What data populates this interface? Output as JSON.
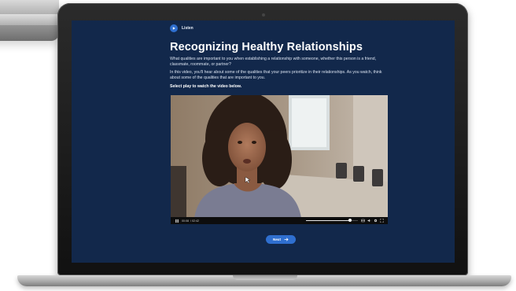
{
  "header": {
    "section_label": "Listen",
    "section_icon": "play-circle-icon"
  },
  "content": {
    "title": "Recognizing Healthy Relationships",
    "paragraph_1": "What qualities are important to you when establishing a relationship with someone, whether this person is a friend, classmate, roommate, or partner?",
    "paragraph_2": "In this video, you'll hear about some of the qualities that your peers prioritize in their relationships. As you watch, think about some of the qualities that are important to you.",
    "instruction": "Select play to watch the video below."
  },
  "player": {
    "current_time": "00:08",
    "duration": "/ 02:42",
    "progress_fraction": 0.05,
    "volume_fraction": 0.85,
    "icons": [
      "play-icon",
      "closed-captions-icon",
      "volume-icon",
      "settings-gear-icon",
      "fullscreen-icon"
    ]
  },
  "footer": {
    "next_label": "Next",
    "next_icon": "arrow-right-icon"
  },
  "colors": {
    "screen_background": "#12284b",
    "accent": "#2f6fcf",
    "title": "#ffffff"
  }
}
